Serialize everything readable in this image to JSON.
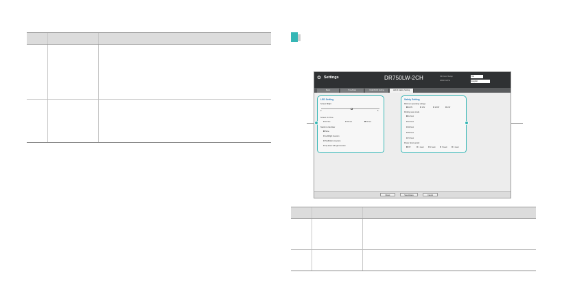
{
  "screenshot": {
    "title": "Settings",
    "model": "DR750LW-2CH",
    "option_1": "SD Card Setup",
    "option_2": "WDR DATE",
    "select_1": "5%",
    "select_2": "English",
    "tabs": [
      "Basic",
      "Time/Date",
      "GSENSOR Setting",
      "LED & Safety Setting"
    ],
    "led_panel": {
      "title": "LED Setting",
      "brightness_label": "Screen Bright",
      "slider_min": "0",
      "slider_max": "5",
      "screen_on_time_label": "Screen On Time",
      "screen_on_time_options": [
        "10 Sec",
        "30 sec",
        "60 sec"
      ],
      "switch_label": "Switch to the Rear",
      "switch_options": [
        "None",
        "Left/Right inversion",
        "Top/Bottom inversion",
        "Up-down/ left-right inversion"
      ]
    },
    "safety_panel": {
      "title": "Safety Setting",
      "voltage_label": "Minimum operating voltage",
      "voltage_options": [
        "11.8V",
        "12V",
        "23.8V",
        "24V"
      ],
      "parking_label": "Parking save mode",
      "parking_options": [
        "12 hour",
        "24 hour",
        "48 hour",
        "60 hour",
        "72 hour"
      ],
      "power_label": "Power down period",
      "power_options": [
        "Off",
        "1 week",
        "2 week",
        "3 week",
        "4 week"
      ]
    },
    "buttons": [
      "Reset",
      "Save&Save",
      "Cancel"
    ]
  },
  "colors": {
    "accent": "#35b6b5",
    "title_bar": "#2f3133"
  }
}
